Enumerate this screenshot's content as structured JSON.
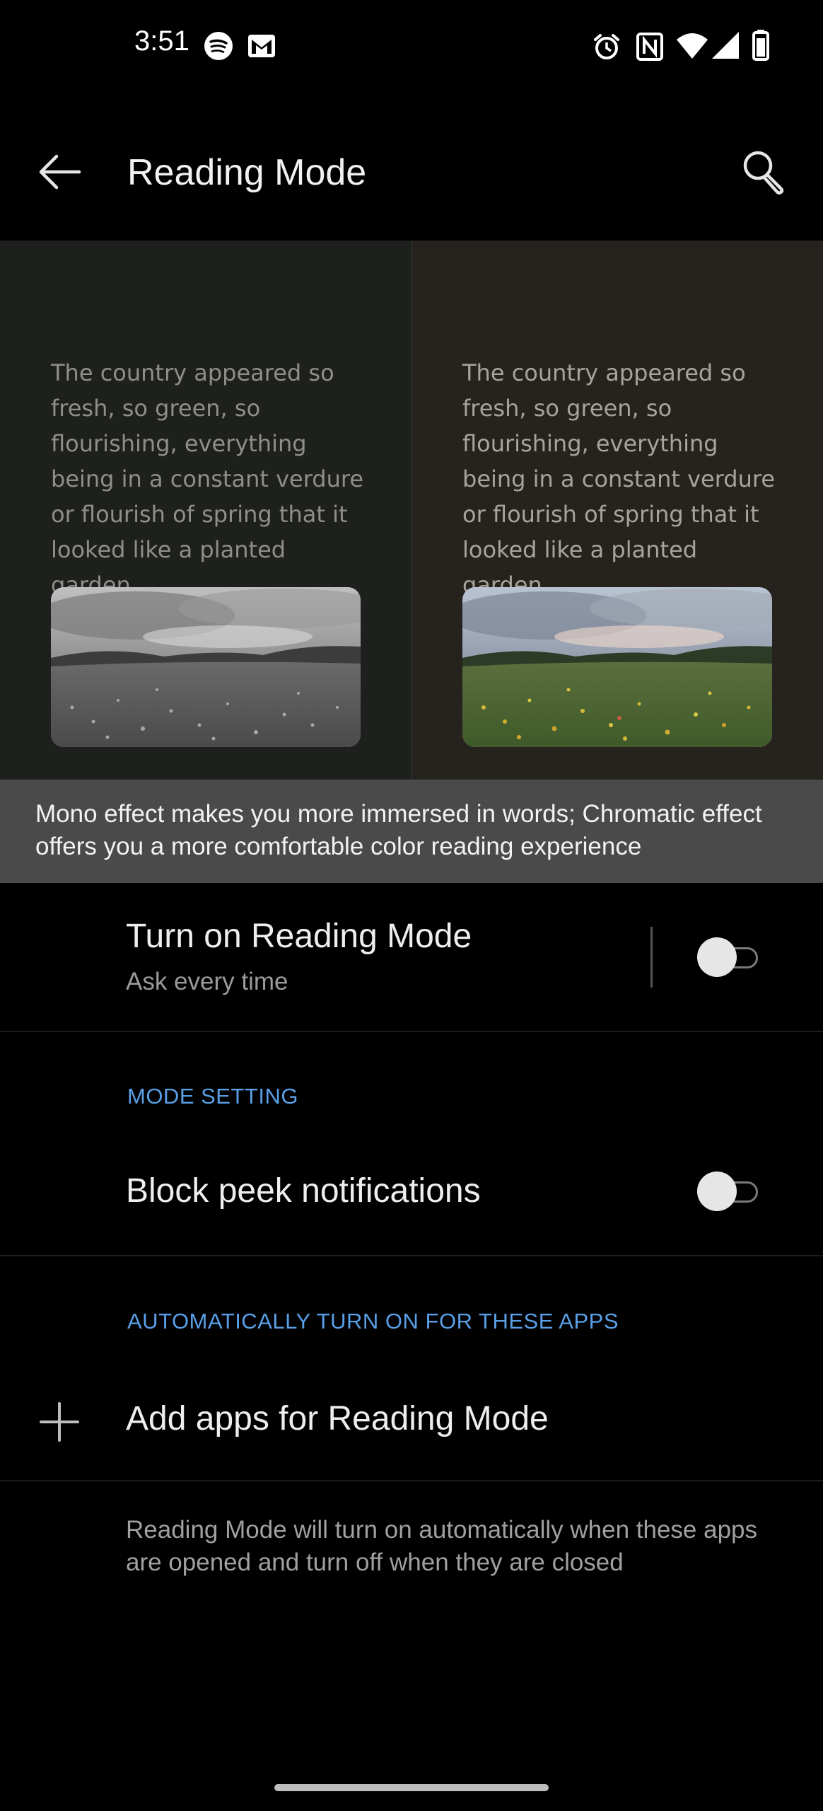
{
  "status_bar": {
    "time": "3:51",
    "left_icons": [
      "spotify-icon",
      "gmail-icon"
    ],
    "right_icons": [
      "alarm-icon",
      "nfc-icon",
      "wifi-icon",
      "signal-icon",
      "battery-icon"
    ]
  },
  "toolbar": {
    "title": "Reading Mode",
    "back_icon": "arrow-left-icon",
    "search_icon": "search-icon"
  },
  "preview": {
    "mono_text": "The country appeared so fresh, so green, so flourishing, everything being in a constant verdure or flourish of spring that it looked like a planted garden.",
    "chromatic_text": "The country appeared so fresh, so green, so flourishing, everything being in a constant verdure or flourish of spring that it looked like a planted garden."
  },
  "description": "Mono effect makes you more immersed in words; Chromatic effect offers you a more comfortable color reading experience",
  "reading_mode_row": {
    "title": "Turn on Reading Mode",
    "subtitle": "Ask every time",
    "enabled": false
  },
  "mode_setting": {
    "header": "MODE SETTING",
    "block_peek": {
      "title": "Block peek notifications",
      "enabled": false
    }
  },
  "auto_apps": {
    "header": "AUTOMATICALLY TURN ON FOR THESE APPS",
    "add_label": "Add apps for Reading Mode",
    "note": "Reading Mode will turn on automatically when these apps are opened and turn off when they are closed"
  },
  "colors": {
    "accent": "#5a9fe6",
    "background": "#000000",
    "banner": "#4a4a4a"
  }
}
